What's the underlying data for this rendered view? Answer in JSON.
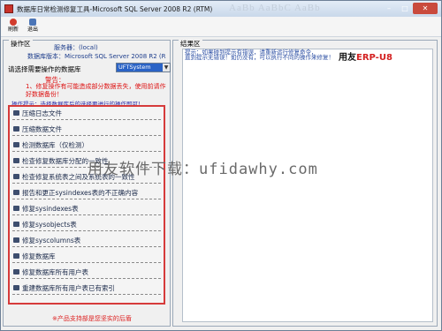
{
  "window": {
    "title": "数据库日常检测修复工具-Microsoft SQL Server 2008 R2 (RTM)",
    "title_ghost": "AaBb  AaBbC  AaBb",
    "min_label": "–",
    "max_label": "□",
    "close_label": "✕"
  },
  "toolbar": {
    "refresh_label": "刷新",
    "exit_label": "退出"
  },
  "left_panel": {
    "legend": "操作区",
    "server_label": "服务器：(local)",
    "version_label": "数据库版本：Microsoft SQL Server 2008 R2 (R",
    "select_label": "请选择需要操作的数据库",
    "select_value": "UFTSystem",
    "warning_title": "警告：",
    "warning_text": "1、修复操作有可能造成部分数据丢失，使用前请作好数据备份！",
    "tip_text": "操作提示：选择数据库后的选择要进行的操作即可！",
    "operations": [
      "压缩日志文件",
      "压缩数据文件",
      "检测数据库（仅检测）",
      "检查修复数据库分配的一致性",
      "检查修复系统表之间及系统表的一致性",
      "报告和更正sysindexes表的不正确内容",
      "修复sysindexes表",
      "修复sysobjects表",
      "修复syscolumns表",
      "修复数据库",
      "修复数据库所有用户表",
      "重建数据库所有用户表已有索引"
    ]
  },
  "right_panel": {
    "legend": "结果区",
    "ad_line1": "提示：如果碰到提示有错误，请重新运行修复命令，",
    "ad_line2": "直到提示无错误！如仍没有，可以执行不同的操作来修复！",
    "brand_black": "用友",
    "brand_red": "ERP-U8"
  },
  "watermark": "用友软件下载：ufidawhy.com",
  "footer": "※产品支持部是您坚实的后盾",
  "colors": {
    "highlight_box": "#d63b3b",
    "warning": "#dd1111",
    "select_bg": "#2a63c6"
  }
}
